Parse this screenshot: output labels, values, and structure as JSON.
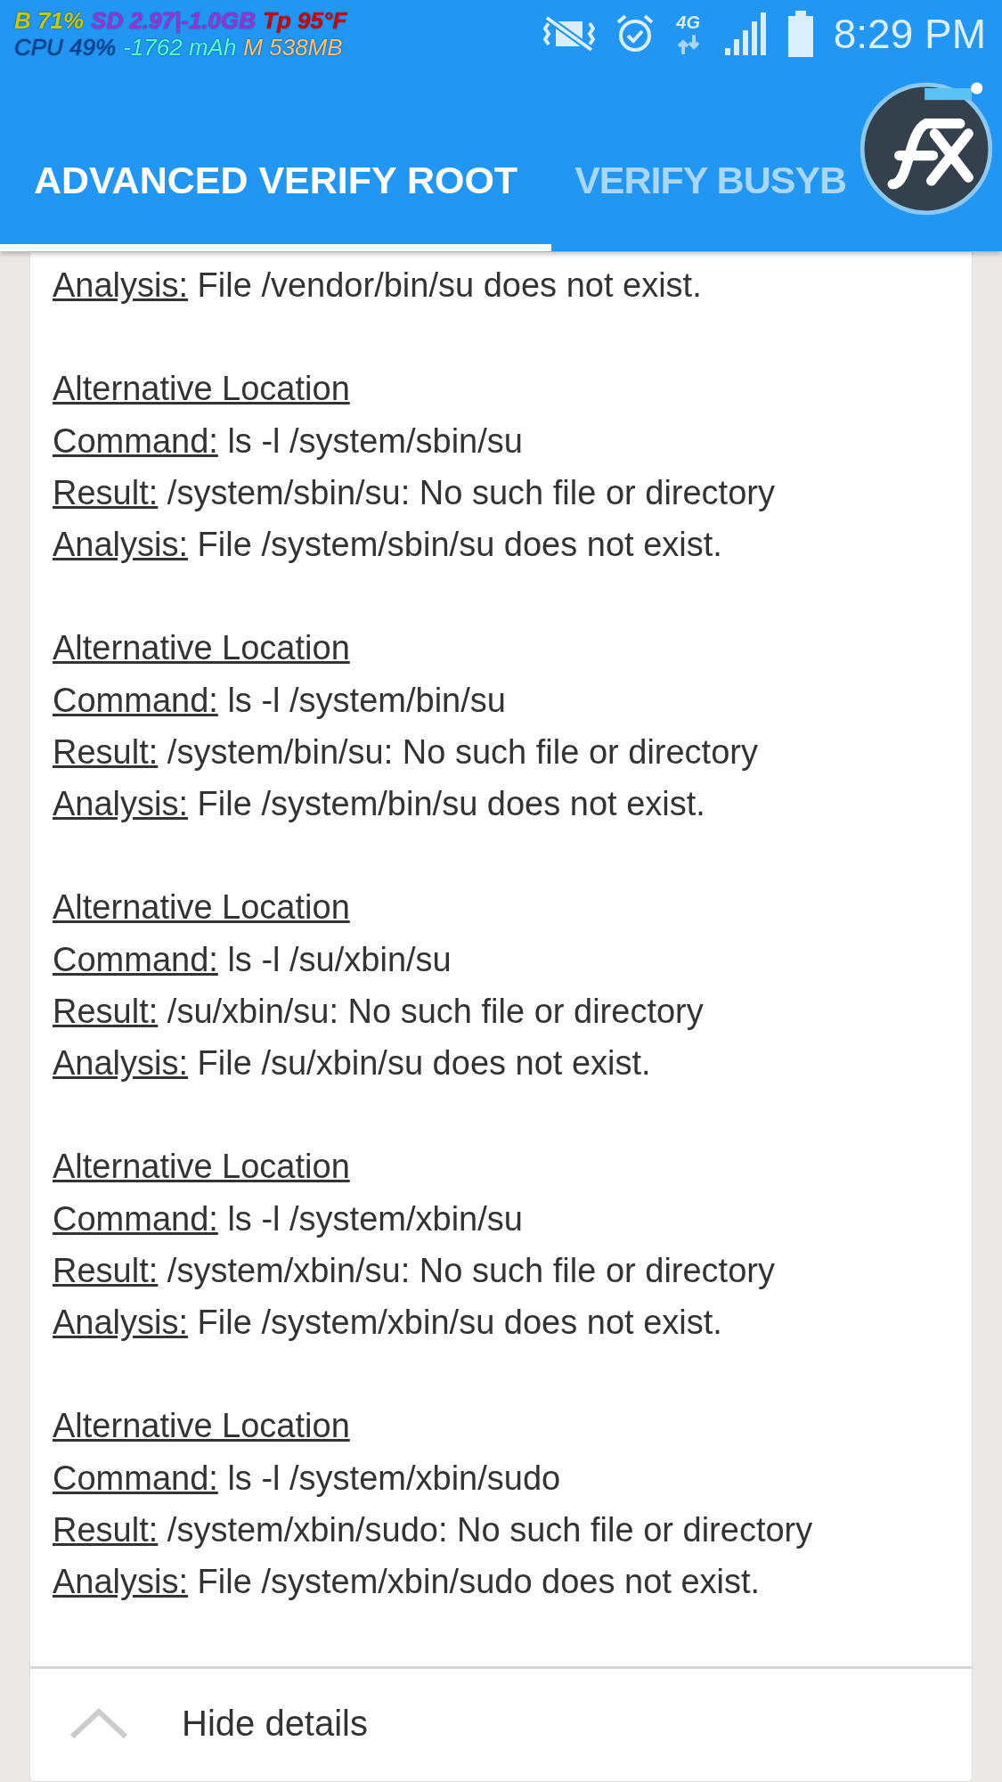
{
  "status_bar": {
    "overlay": [
      {
        "text": "B 71%",
        "color": "#c8c800"
      },
      {
        "text": "SD 2.97|-1.0GB",
        "color": "#9b30d9"
      },
      {
        "text": "Tp 95°F",
        "color": "#d00000"
      }
    ],
    "overlay_2": [
      {
        "text": "CPU 49%",
        "color": "#003c8f"
      },
      {
        "text": "-1762 mAh",
        "color": "#50ffc8"
      },
      {
        "text": "M 538MB",
        "color": "#ffc070"
      }
    ],
    "time": "8:29 PM",
    "network": "4G"
  },
  "tabs": [
    {
      "label": "ADVANCED VERIFY ROOT",
      "selected": true
    },
    {
      "label": "VERIFY BUSYB",
      "selected": false
    }
  ],
  "details": [
    {
      "kind": "line",
      "label": "Analysis:",
      "text": "File /vendor/bin/su does not exist."
    },
    {
      "kind": "gap"
    },
    {
      "kind": "heading",
      "text": "Alternative Location"
    },
    {
      "kind": "line",
      "label": "Command:",
      "text": "ls -l /system/sbin/su"
    },
    {
      "kind": "line",
      "label": "Result:",
      "text": "/system/sbin/su: No such file or directory"
    },
    {
      "kind": "line",
      "label": "Analysis:",
      "text": "File /system/sbin/su does not exist."
    },
    {
      "kind": "gap"
    },
    {
      "kind": "heading",
      "text": "Alternative Location"
    },
    {
      "kind": "line",
      "label": "Command:",
      "text": "ls -l /system/bin/su"
    },
    {
      "kind": "line",
      "label": "Result:",
      "text": "/system/bin/su: No such file or directory"
    },
    {
      "kind": "line",
      "label": "Analysis:",
      "text": "File /system/bin/su does not exist."
    },
    {
      "kind": "gap"
    },
    {
      "kind": "heading",
      "text": "Alternative Location"
    },
    {
      "kind": "line",
      "label": "Command:",
      "text": "ls -l /su/xbin/su"
    },
    {
      "kind": "line",
      "label": "Result:",
      "text": "/su/xbin/su: No such file or directory"
    },
    {
      "kind": "line",
      "label": "Analysis:",
      "text": "File /su/xbin/su does not exist."
    },
    {
      "kind": "gap"
    },
    {
      "kind": "heading",
      "text": "Alternative Location"
    },
    {
      "kind": "line",
      "label": "Command:",
      "text": "ls -l /system/xbin/su"
    },
    {
      "kind": "line",
      "label": "Result:",
      "text": "/system/xbin/su: No such file or directory"
    },
    {
      "kind": "line",
      "label": "Analysis:",
      "text": "File /system/xbin/su does not exist."
    },
    {
      "kind": "gap"
    },
    {
      "kind": "heading",
      "text": "Alternative Location"
    },
    {
      "kind": "line",
      "label": "Command:",
      "text": "ls -l /system/xbin/sudo"
    },
    {
      "kind": "line",
      "label": "Result:",
      "text": "/system/xbin/sudo: No such file or directory"
    },
    {
      "kind": "line",
      "label": "Analysis:",
      "text": "File /system/xbin/sudo does not exist."
    }
  ],
  "toggle": {
    "label": "Hide details",
    "expanded": true
  }
}
